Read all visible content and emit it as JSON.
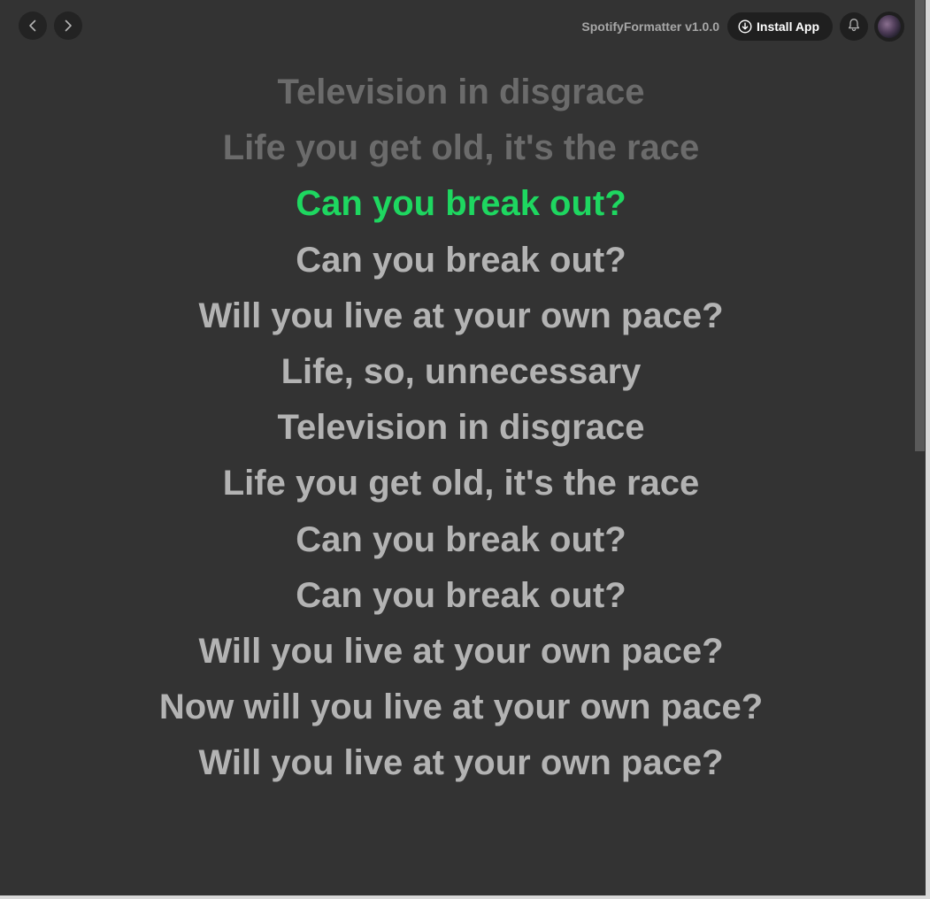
{
  "header": {
    "app_name": "SpotifyFormatter v1.0.0",
    "install_label": "Install App",
    "icons": {
      "back": "chevron-left-icon",
      "forward": "chevron-right-icon",
      "install": "download-circle-icon",
      "bell": "bell-icon",
      "avatar": "user-avatar"
    }
  },
  "lyrics": {
    "active_index": 2,
    "lines": [
      "Television in disgrace",
      "Life you get old, it's the race",
      "Can you break out?",
      "Can you break out?",
      "Will you live at your own pace?",
      "Life, so, unnecessary",
      "Television in disgrace",
      "Life you get old, it's the race",
      "Can you break out?",
      "Can you break out?",
      "Will you live at your own pace?",
      "Now will you live at your own pace?",
      "Will you live at your own pace?"
    ]
  },
  "colors": {
    "background": "#333333",
    "active_lyric": "#1ed760",
    "past_lyric": "#6b6b6b",
    "upcoming_lyric": "#b3b3b3"
  }
}
